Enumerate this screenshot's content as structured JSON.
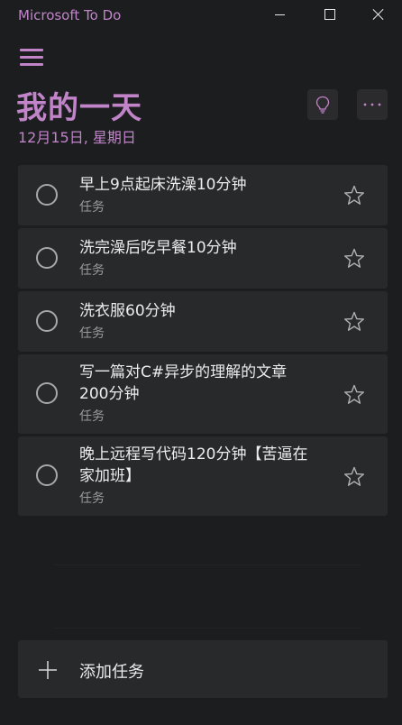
{
  "app": {
    "title": "Microsoft To Do",
    "accent": "#c184c9"
  },
  "header": {
    "title": "我的一天",
    "date": "12月15日, 星期日",
    "suggestions_icon": "lightbulb-icon",
    "more_icon": "more-horizontal-icon"
  },
  "tasks": [
    {
      "title": "早上9点起床洗澡10分钟",
      "list": "任务",
      "completed": false,
      "important": false
    },
    {
      "title": "洗完澡后吃早餐10分钟",
      "list": "任务",
      "completed": false,
      "important": false
    },
    {
      "title": "洗衣服60分钟",
      "list": "任务",
      "completed": false,
      "important": false
    },
    {
      "title": "写一篇对C#异步的理解的文章200分钟",
      "list": "任务",
      "completed": false,
      "important": false
    },
    {
      "title": "晚上远程写代码120分钟【苦逼在家加班】",
      "list": "任务",
      "completed": false,
      "important": false
    }
  ],
  "add_task": {
    "label": "添加任务"
  }
}
